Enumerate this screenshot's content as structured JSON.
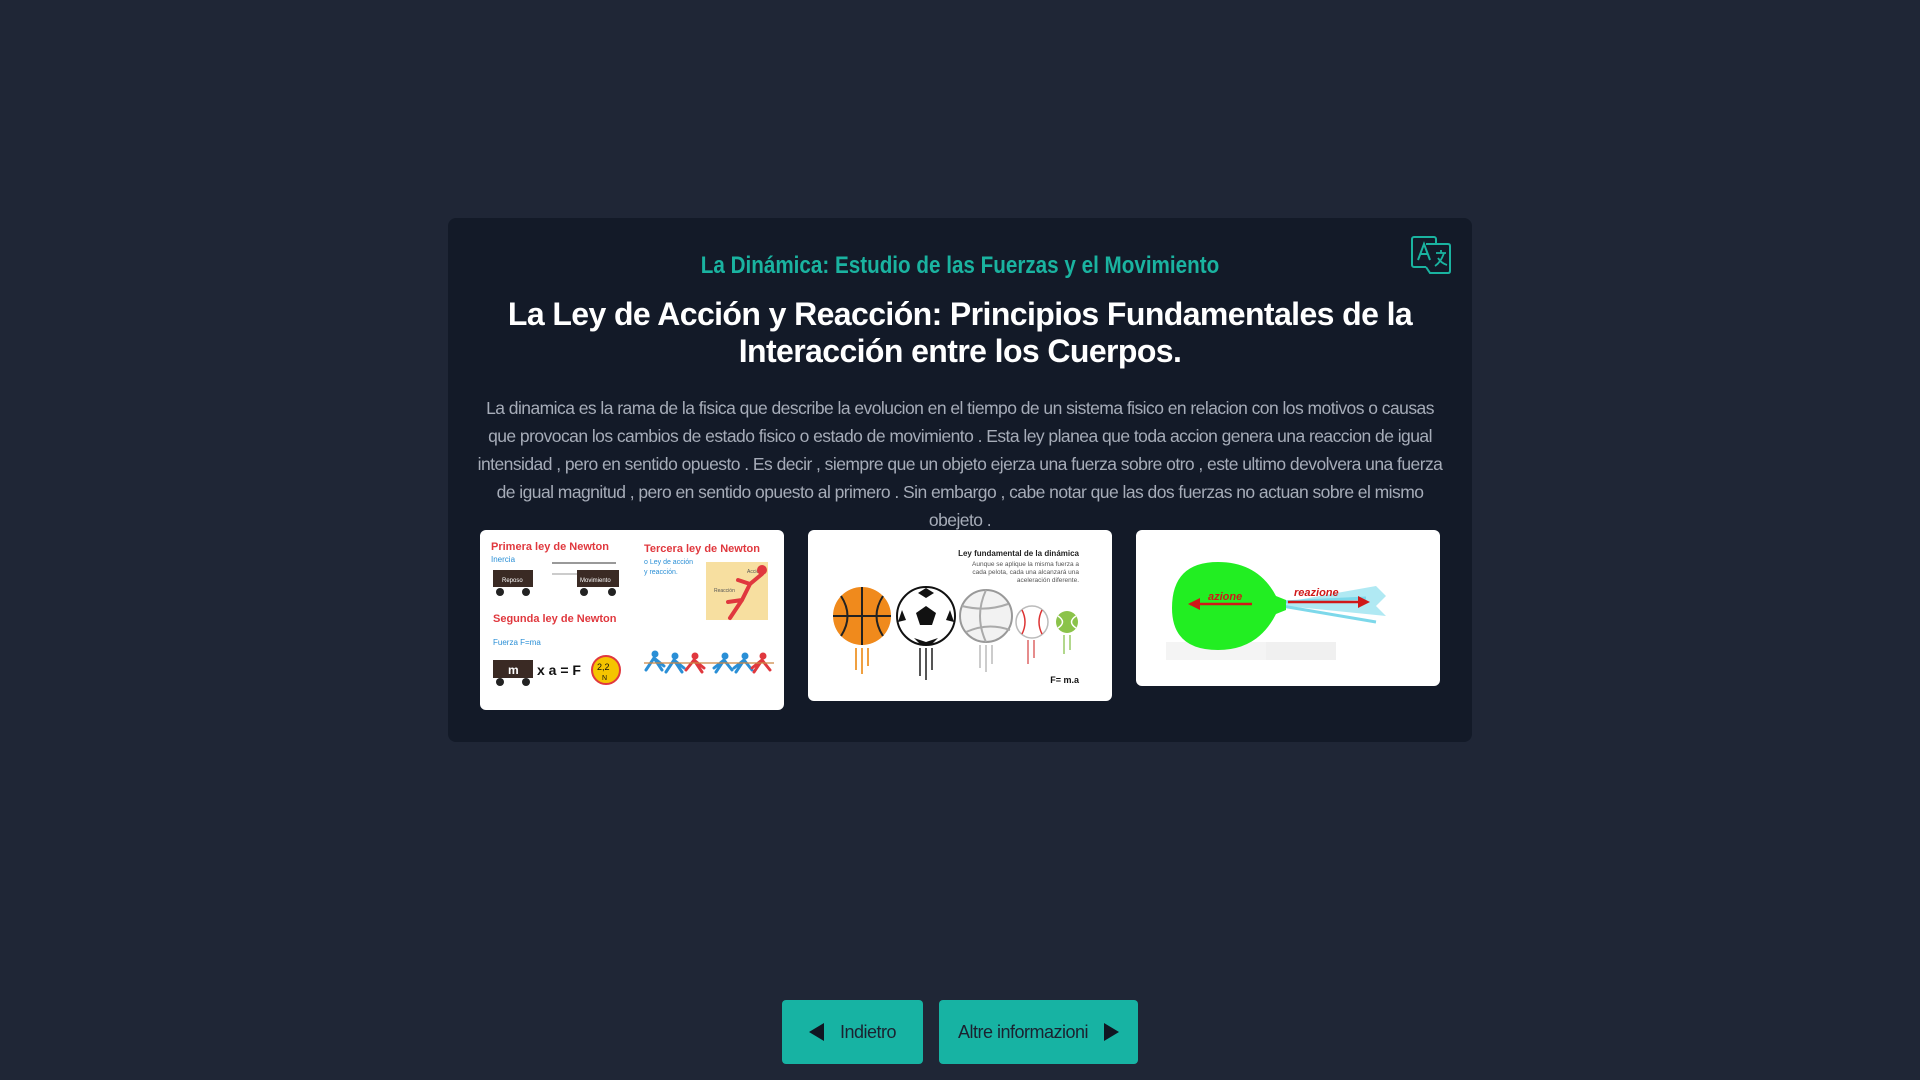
{
  "card": {
    "subtitle": "La Dinámica: Estudio de las Fuerzas y el Movimiento",
    "title": "La Ley de Acción y Reacción: Principios Fundamentales de la Interacción entre los Cuerpos.",
    "description": "La dinamica es la rama de la fisica que describe la evolucion en el tiempo de un sistema fisico en relacion con los motivos o causas que provocan los cambios de estado fisico o estado de movimiento . Esta ley planea que toda accion genera una reaccion de igual intensidad , pero en sentido opuesto . Es decir , siempre que un objeto ejerza una fuerza sobre otro , este ultimo devolvera una fuerza de igual magnitud , pero en sentido opuesto al primero . Sin embargo , cabe notar que las dos fuerzas no actuan sobre el mismo obejeto .",
    "translate_icon": "translate-icon"
  },
  "images": {
    "newton_laws": {
      "first_law": "Primera ley de Newton",
      "inertia": "Inercia",
      "rest": "Reposo",
      "movement": "Movimiento",
      "second_law": "Segunda ley de Newton",
      "force_formula": "Fuerza F=ma",
      "mass": "m",
      "equation": "x a = F",
      "force_value": "2,2",
      "force_unit": "N",
      "third_law": "Tercera ley de Newton",
      "third_law_sub1": "o Ley de acción",
      "third_law_sub2": "y reacción.",
      "action": "Acción",
      "reaction": "Reacción"
    },
    "dynamics_balls": {
      "heading": "Ley fundamental de la dinámica",
      "line1": "Aunque se aplique la misma fuerza a",
      "line2": "cada pelota, cada una alcanzará una",
      "line3": "aceleración diferente.",
      "formula": "F= m.a"
    },
    "action_reaction": {
      "left_label": "azione",
      "right_label": "reazione"
    }
  },
  "buttons": {
    "back_label": "Indietro",
    "more_label": "Altre informazioni"
  },
  "colors": {
    "background": "#1f2636",
    "card": "#131a28",
    "accent": "#1ab3a0",
    "button": "#17b3a3"
  }
}
